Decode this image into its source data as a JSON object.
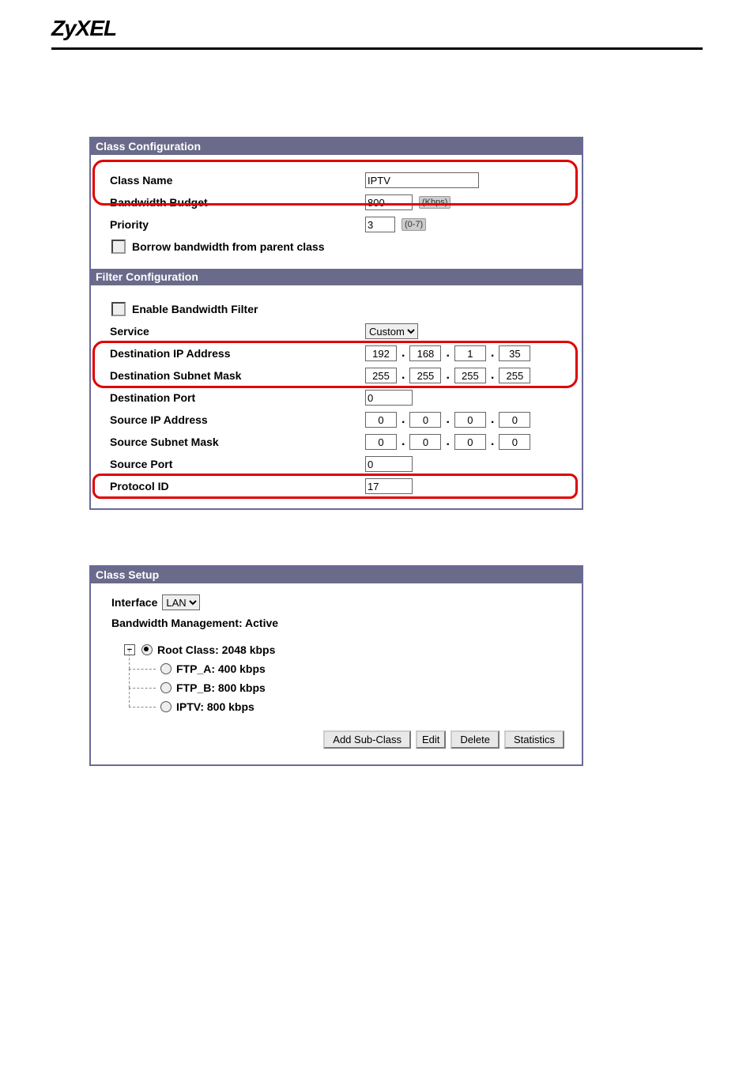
{
  "header": {
    "logo": "ZyXEL"
  },
  "class_config": {
    "title": "Class Configuration",
    "class_name_label": "Class Name",
    "class_name_value": "IPTV",
    "bandwidth_budget_label": "Bandwidth Budget",
    "bandwidth_budget_value": "800",
    "bandwidth_unit": "(Kbps)",
    "priority_label": "Priority",
    "priority_value": "3",
    "priority_hint": "(0-7)",
    "borrow_label": "Borrow bandwidth from parent class"
  },
  "filter_config": {
    "title": "Filter Configuration",
    "enable_label": "Enable Bandwidth Filter",
    "service_label": "Service",
    "service_value": "Custom",
    "dest_ip_label": "Destination IP Address",
    "dest_ip": [
      "192",
      "168",
      "1",
      "35"
    ],
    "dest_mask_label": "Destination Subnet Mask",
    "dest_mask": [
      "255",
      "255",
      "255",
      "255"
    ],
    "dest_port_label": "Destination Port",
    "dest_port_value": "0",
    "src_ip_label": "Source IP Address",
    "src_ip": [
      "0",
      "0",
      "0",
      "0"
    ],
    "src_mask_label": "Source Subnet Mask",
    "src_mask": [
      "0",
      "0",
      "0",
      "0"
    ],
    "src_port_label": "Source Port",
    "src_port_value": "0",
    "protocol_label": "Protocol ID",
    "protocol_value": "17"
  },
  "class_setup": {
    "title": "Class Setup",
    "interface_label": "Interface",
    "interface_value": "LAN",
    "bm_status": "Bandwidth Management: Active",
    "root_label": "Root Class: 2048 kbps",
    "children": [
      {
        "label": "FTP_A: 400 kbps"
      },
      {
        "label": "FTP_B: 800 kbps"
      },
      {
        "label": "IPTV: 800 kbps"
      }
    ],
    "buttons": {
      "add": "Add Sub-Class",
      "edit": "Edit",
      "delete": "Delete",
      "stats": "Statistics"
    }
  }
}
